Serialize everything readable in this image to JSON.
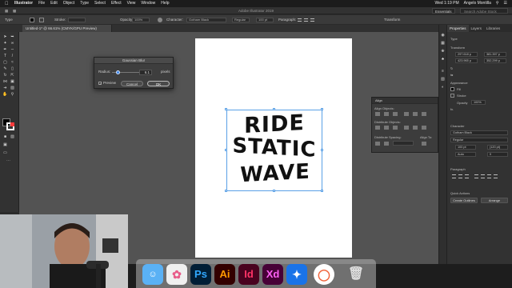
{
  "menubar": {
    "items": [
      "Illustrator",
      "File",
      "Edit",
      "Object",
      "Type",
      "Select",
      "Effect",
      "View",
      "Window",
      "Help"
    ],
    "clock": "Wed 1:19 PM",
    "user": "Angelo Montilla"
  },
  "appbar": {
    "title": "Adobe Illustrator 2019",
    "workspace": "Essentials",
    "search_placeholder": "Search Adobe Stock"
  },
  "controlbar": {
    "type_label": "Type",
    "stroke_label": "Stroke:",
    "opacity_label": "Opacity:",
    "opacity_value": "100%",
    "character_label": "Character:",
    "font_value": "Gotham Black",
    "style_value": "Regular",
    "size_value": "100 pt",
    "paragraph_label": "Paragraph:",
    "transform_label": "Transform"
  },
  "document": {
    "tab_label": "Untitled-1* @ 66.61% (CMYK/GPU Preview)"
  },
  "artwork": {
    "line1": "RIDE",
    "line2": "STATIC",
    "line3": "WAVE"
  },
  "dialog": {
    "title": "Gaussian Blur",
    "radius_label": "Radius:",
    "radius_value": "6.1",
    "unit": "pixels",
    "preview_label": "Preview",
    "cancel_label": "Cancel",
    "ok_label": "OK",
    "radius_fraction": 0.14
  },
  "align_panel": {
    "title": "Align",
    "align_objects": "Align Objects:",
    "distribute_objects": "Distribute Objects:",
    "distribute_spacing": "Distribute Spacing:",
    "align_to": "Align To:"
  },
  "properties": {
    "tabs": [
      "Properties",
      "Layers",
      "Libraries"
    ],
    "type_heading": "Type",
    "transform_heading": "Transform",
    "x_value": "297.618 p",
    "y_value": "381.397 p",
    "w_value": "423.965 p",
    "h_value": "352.299 p",
    "appearance_heading": "Appearance",
    "fill_label": "Fill",
    "stroke_label": "Stroke",
    "opacity_label": "Opacity",
    "opacity_value": "100%",
    "fx_label": "fx.",
    "character_heading": "Character",
    "font_value": "Gotham Black",
    "style_value": "Regular",
    "size_value": "100 pt",
    "leading_value": "(120 pt)",
    "tracking_value": "Auto",
    "kerning_value": "0",
    "paragraph_heading": "Paragraph",
    "quick_actions_heading": "Quick Actions",
    "create_outlines_label": "Create Outlines",
    "arrange_label": "Arrange"
  },
  "dock": {
    "ps_label": "Ps",
    "ai_label": "Ai",
    "id_label": "Id",
    "xd_label": "Xd"
  },
  "colors": {
    "accent_blue": "#3d86e8",
    "ai_orange": "#ff9a00",
    "id_pink": "#ff3366",
    "xd_magenta": "#ff61f6",
    "ps_blue": "#31a8ff"
  }
}
